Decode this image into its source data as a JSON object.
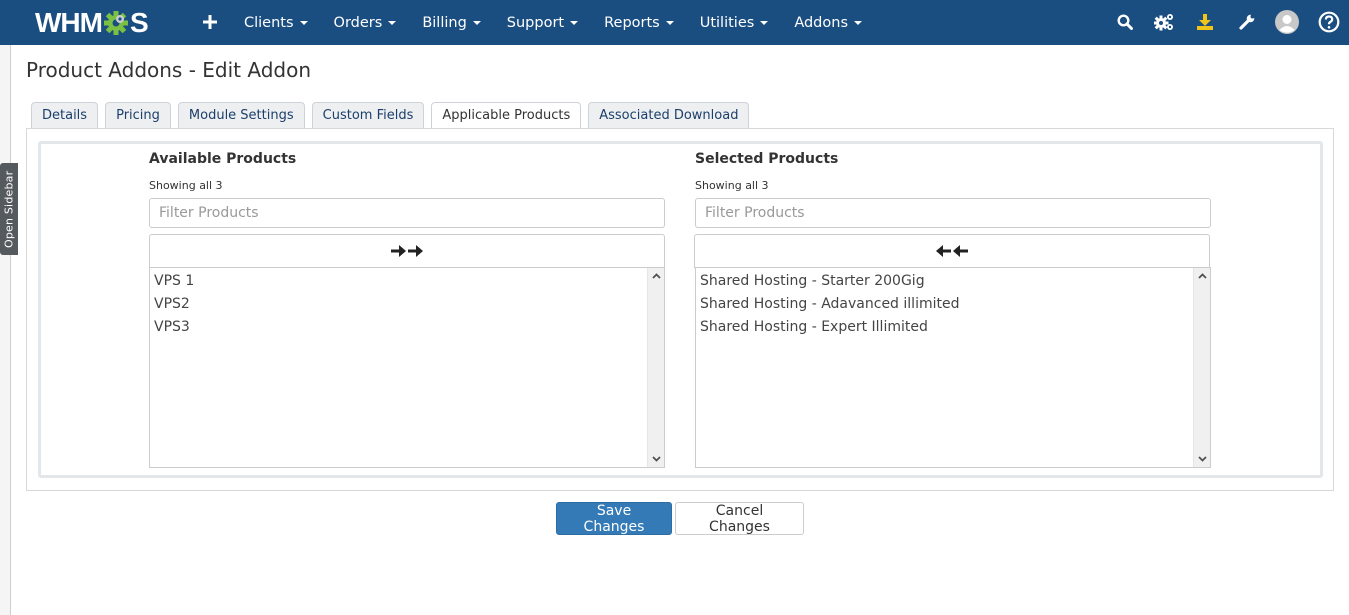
{
  "navbar": {
    "logo": {
      "left": "WHM",
      "right": "S"
    },
    "add_icon": "plus-icon",
    "menu": [
      {
        "label": "Clients"
      },
      {
        "label": "Orders"
      },
      {
        "label": "Billing"
      },
      {
        "label": "Support"
      },
      {
        "label": "Reports"
      },
      {
        "label": "Utilities"
      },
      {
        "label": "Addons"
      }
    ],
    "right_icons": [
      "search-icon",
      "cogs-icon",
      "download-icon",
      "wrench-icon",
      "user-avatar-icon",
      "help-icon"
    ],
    "download_icon_color": "#f0c419",
    "bg_color": "#1a4d80"
  },
  "sidebar": {
    "toggle_label": "Open Sidebar"
  },
  "page": {
    "title": "Product Addons - Edit Addon"
  },
  "tabs": [
    {
      "label": "Details",
      "active": false
    },
    {
      "label": "Pricing",
      "active": false
    },
    {
      "label": "Module Settings",
      "active": false
    },
    {
      "label": "Custom Fields",
      "active": false
    },
    {
      "label": "Applicable Products",
      "active": true
    },
    {
      "label": "Associated Download",
      "active": false
    }
  ],
  "available": {
    "header": "Available Products",
    "showing": "Showing all 3",
    "filter_placeholder": "Filter Products",
    "filter_value": "",
    "move_icon": "double-arrow-right-icon",
    "items": [
      "VPS 1",
      "VPS2",
      "VPS3"
    ]
  },
  "selected": {
    "header": "Selected Products",
    "showing": "Showing all 3",
    "filter_placeholder": "Filter Products",
    "filter_value": "",
    "move_icon": "double-arrow-left-icon",
    "items": [
      "Shared Hosting - Starter 200Gig",
      "Shared Hosting - Adavanced illimited",
      "Shared Hosting - Expert Illimited"
    ]
  },
  "actions": {
    "save_label": "Save Changes",
    "cancel_label": "Cancel Changes",
    "primary_color": "#337ab7"
  }
}
